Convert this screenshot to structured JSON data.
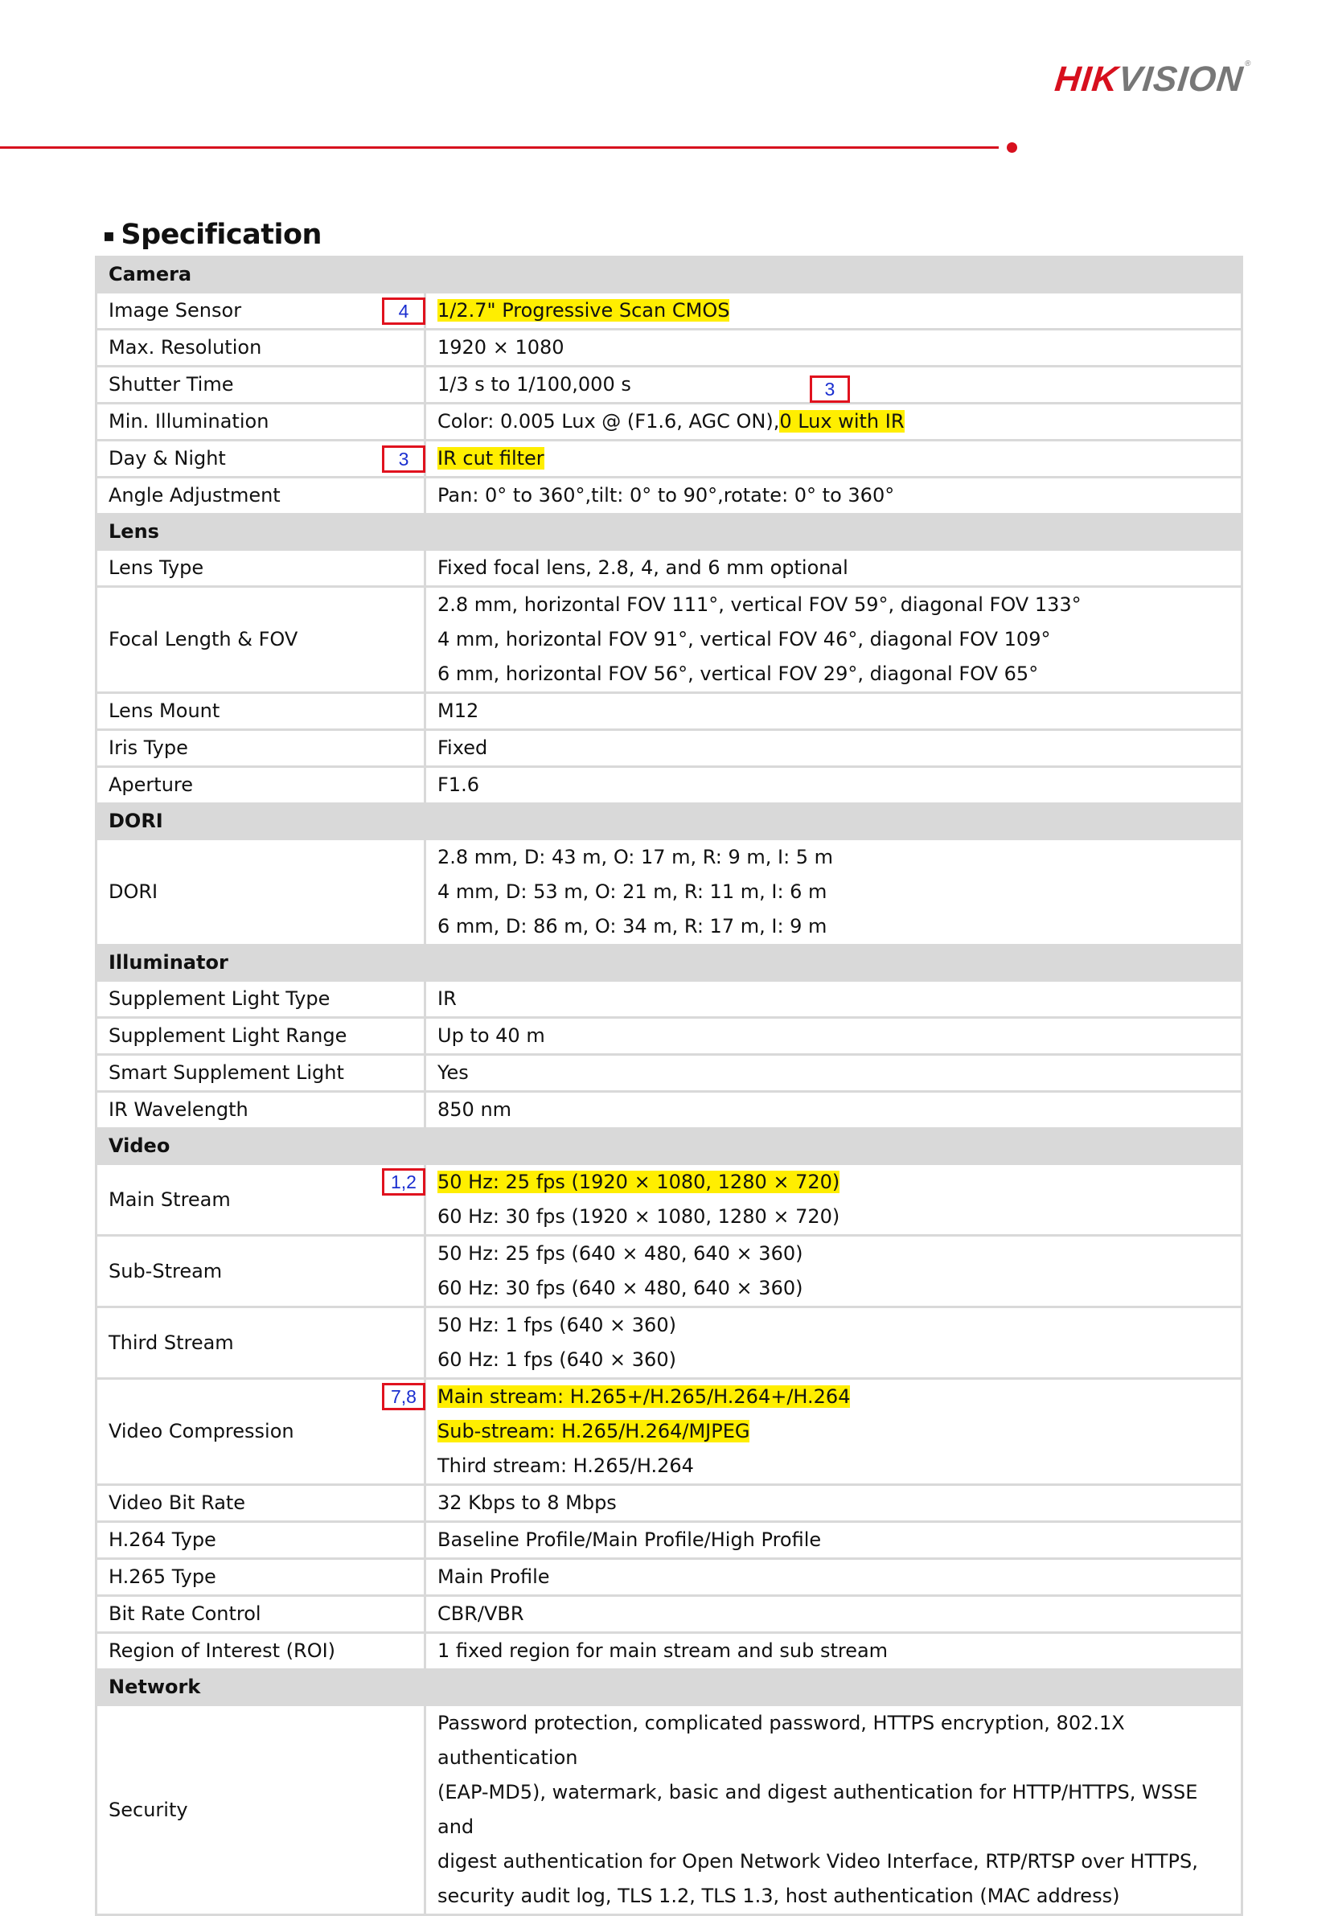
{
  "header": {
    "brand_part1": "HIK",
    "brand_part2": "VISION",
    "registered_mark": "®",
    "brand_color": "#d7101e",
    "brand_gray": "#777777"
  },
  "title": "Specification",
  "title_bullet": "▪",
  "highlight_color": "#ffee00",
  "annotation_border_color": "#e0121e",
  "annotation_text_color": "#1a2ed0",
  "sections": [
    {
      "name": "Camera",
      "rows": [
        {
          "label": "Image Sensor",
          "annotation": "4",
          "values": [
            {
              "text": "1/2.7\" Progressive Scan CMOS",
              "highlight": true
            }
          ]
        },
        {
          "label": "Max. Resolution",
          "values": [
            {
              "text": "1920 × 1080"
            }
          ]
        },
        {
          "label": "Shutter Time",
          "values": [
            {
              "text": "1/3 s to 1/100,000 s"
            }
          ],
          "inline_annotation": "3"
        },
        {
          "label": "Min. Illumination",
          "values": [
            {
              "text": "Color: 0.005 Lux @ (F1.6, AGC ON),",
              "highlight_suffix": "0 Lux with IR"
            }
          ]
        },
        {
          "label": "Day & Night",
          "annotation": "3",
          "values": [
            {
              "text": "IR cut filter",
              "highlight": true
            }
          ]
        },
        {
          "label": "Angle Adjustment",
          "values": [
            {
              "text": "Pan: 0° to 360°,tilt: 0° to 90°,rotate: 0° to 360°"
            }
          ]
        }
      ]
    },
    {
      "name": "Lens",
      "rows": [
        {
          "label": "Lens Type",
          "values": [
            {
              "text": "Fixed focal lens, 2.8, 4, and 6 mm optional"
            }
          ]
        },
        {
          "label": "Focal Length & FOV",
          "values": [
            {
              "text": "2.8 mm, horizontal FOV 111°, vertical FOV 59°, diagonal FOV 133°"
            },
            {
              "text": "4 mm, horizontal FOV 91°, vertical FOV 46°, diagonal FOV 109°"
            },
            {
              "text": "6 mm, horizontal FOV 56°, vertical FOV 29°, diagonal FOV 65°"
            }
          ]
        },
        {
          "label": "Lens Mount",
          "values": [
            {
              "text": "M12"
            }
          ]
        },
        {
          "label": "Iris Type",
          "values": [
            {
              "text": "Fixed"
            }
          ]
        },
        {
          "label": "Aperture",
          "values": [
            {
              "text": "F1.6"
            }
          ]
        }
      ]
    },
    {
      "name": "DORI",
      "rows": [
        {
          "label": "DORI",
          "values": [
            {
              "text": "2.8 mm, D: 43 m, O: 17 m, R: 9 m, I: 5 m"
            },
            {
              "text": "4 mm, D: 53 m, O: 21 m, R: 11 m, I: 6 m"
            },
            {
              "text": "6 mm, D: 86 m, O: 34 m, R: 17 m, I: 9 m"
            }
          ]
        }
      ]
    },
    {
      "name": "Illuminator",
      "rows": [
        {
          "label": "Supplement Light Type",
          "values": [
            {
              "text": "IR"
            }
          ]
        },
        {
          "label": "Supplement Light Range",
          "values": [
            {
              "text": "Up to 40 m"
            }
          ]
        },
        {
          "label": "Smart Supplement Light",
          "values": [
            {
              "text": "Yes"
            }
          ]
        },
        {
          "label": "IR Wavelength",
          "values": [
            {
              "text": "850 nm"
            }
          ]
        }
      ]
    },
    {
      "name": "Video",
      "rows": [
        {
          "label": "Main Stream",
          "annotation": "1,2",
          "values": [
            {
              "text": "50 Hz: 25 fps (1920 × 1080, 1280 × 720)",
              "highlight": true
            },
            {
              "text": "60 Hz: 30 fps (1920 × 1080, 1280 × 720)"
            }
          ]
        },
        {
          "label": "Sub-Stream",
          "values": [
            {
              "text": "50 Hz: 25 fps (640 × 480, 640 × 360)"
            },
            {
              "text": "60 Hz: 30 fps (640 × 480, 640 × 360)"
            }
          ]
        },
        {
          "label": "Third Stream",
          "values": [
            {
              "text": "50 Hz: 1 fps (640 × 360)"
            },
            {
              "text": "60 Hz: 1 fps (640 × 360)"
            }
          ]
        },
        {
          "label": "Video Compression",
          "annotation": "7,8",
          "values": [
            {
              "text": "Main stream: H.265+/H.265/H.264+/H.264",
              "highlight": true
            },
            {
              "text": "Sub-stream: H.265/H.264/MJPEG",
              "highlight": true
            },
            {
              "text": "Third stream: H.265/H.264"
            }
          ]
        },
        {
          "label": "Video Bit Rate",
          "values": [
            {
              "text": "32 Kbps to 8 Mbps"
            }
          ]
        },
        {
          "label": "H.264 Type",
          "values": [
            {
              "text": "Baseline Profile/Main Profile/High Profile"
            }
          ]
        },
        {
          "label": "H.265 Type",
          "values": [
            {
              "text": "Main Profile"
            }
          ]
        },
        {
          "label": "Bit Rate Control",
          "values": [
            {
              "text": "CBR/VBR"
            }
          ]
        },
        {
          "label": "Region of Interest (ROI)",
          "values": [
            {
              "text": "1 fixed region for main stream and sub stream"
            }
          ]
        }
      ]
    },
    {
      "name": "Network",
      "rows": [
        {
          "label": "Security",
          "values": [
            {
              "text": "Password protection, complicated password, HTTPS encryption, 802.1X authentication"
            },
            {
              "text": "(EAP-MD5), watermark, basic and digest authentication for HTTP/HTTPS, WSSE and"
            },
            {
              "text": "digest authentication for Open Network Video Interface, RTP/RTSP over HTTPS,"
            },
            {
              "text": "security audit log, TLS 1.2, TLS 1.3, host authentication (MAC address)"
            }
          ]
        }
      ]
    }
  ]
}
